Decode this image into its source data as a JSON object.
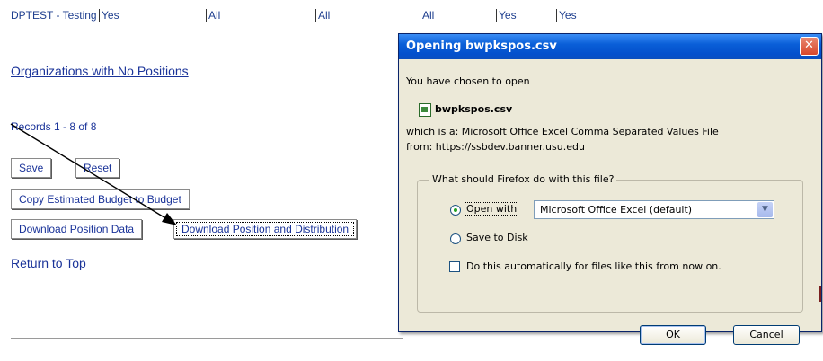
{
  "filter_row": {
    "cells": [
      "DPTEST - Testing",
      "Yes",
      "All",
      "All",
      "All",
      "Yes",
      "Yes",
      ""
    ]
  },
  "page": {
    "section_link": "Organizations with No Positions",
    "records_text": "Records 1 - 8 of 8",
    "buttons": {
      "save": "Save",
      "reset": "Reset",
      "copy_budget": "Copy Estimated Budget to Budget",
      "download_position": "Download Position Data",
      "download_distribution": "Download Position and Distribution"
    },
    "return_link": "Return to Top"
  },
  "dialog": {
    "title": "Opening bwpkspos.csv",
    "close_glyph": "✕",
    "intro": "You have chosen to open",
    "filename": "bwpkspos.csv",
    "which_is_a": "which is a:  Microsoft Office Excel Comma Separated Values File",
    "from": "from:  https://ssbdev.banner.usu.edu",
    "group_label": "What should Firefox do with this file?",
    "open_with_label": "Open with",
    "open_with_value": "Microsoft Office Excel (default)",
    "save_to_disk_label": "Save to Disk",
    "auto_label": "Do this automatically for files like this from now on.",
    "ok": "OK",
    "cancel": "Cancel",
    "open_with_selected": true,
    "auto_checked": false
  },
  "colors": {
    "link": "#1a3399",
    "titlebar": "#0350cc",
    "dialog_bg": "#ece9d8"
  }
}
